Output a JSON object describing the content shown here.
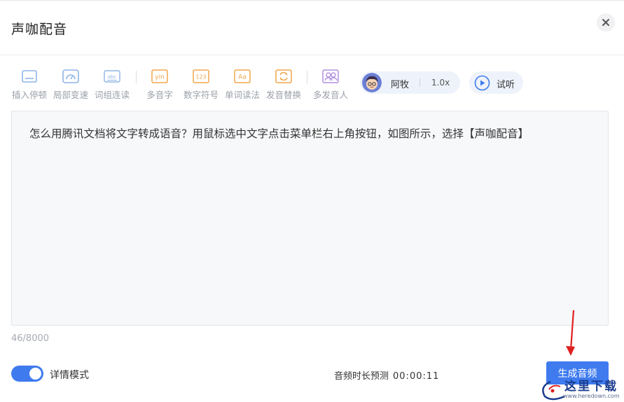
{
  "dialog": {
    "title": "声咖配音"
  },
  "toolbar": {
    "items": [
      {
        "label": "插入停顿",
        "icon": "insert-pause-icon"
      },
      {
        "label": "局部变速",
        "icon": "speed-gauge-icon"
      },
      {
        "label": "词组连读",
        "icon": "phrase-link-icon"
      },
      {
        "label": "多音字",
        "icon": "polyphone-icon",
        "glyph": "yin"
      },
      {
        "label": "数字符号",
        "icon": "number-symbol-icon",
        "glyph": "123"
      },
      {
        "label": "单词读法",
        "icon": "word-reading-icon",
        "glyph": "Aa"
      },
      {
        "label": "发音替换",
        "icon": "pronunciation-swap-icon"
      },
      {
        "label": "多发音人",
        "icon": "multi-speaker-icon"
      }
    ]
  },
  "voice": {
    "name": "阿牧",
    "speed": "1.0x"
  },
  "preview": {
    "label": "试听"
  },
  "editor": {
    "text": "怎么用腾讯文档将文字转成语音？用鼠标选中文字点击菜单栏右上角按钮，如图所示，选择【声咖配音】"
  },
  "counter": "46/8000",
  "detail_mode": {
    "label": "详情模式",
    "enabled": true
  },
  "duration": {
    "label": "音频时长预测",
    "value": "00:00:11"
  },
  "generate": {
    "label": "生成音频"
  },
  "watermark": {
    "brand": "这里下载",
    "url": "www.heredown.com"
  },
  "colors": {
    "accent": "#3f7bef",
    "toolbar_blue": "#8fb4e6",
    "toolbar_orange": "#f0a54a",
    "toolbar_purple": "#b390e0",
    "annotation_red": "#e02020"
  }
}
